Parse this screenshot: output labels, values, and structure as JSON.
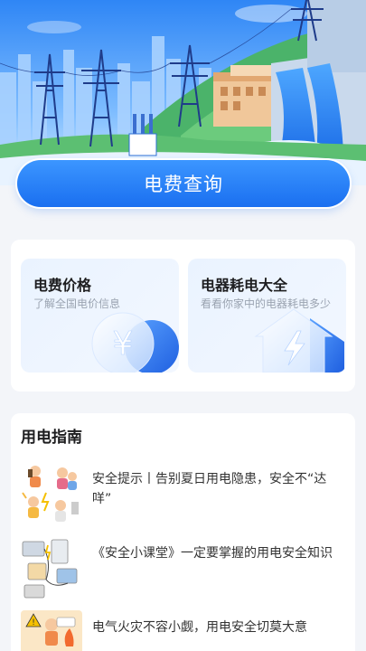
{
  "banner": {
    "query_button_label": "电费查询"
  },
  "tools": [
    {
      "title": "电费价格",
      "subtitle": "了解全国电价信息",
      "icon": "yuan-coin-icon"
    },
    {
      "title": "电器耗电大全",
      "subtitle": "看看你家中的电器耗电多少",
      "icon": "lightning-house-icon"
    }
  ],
  "guide": {
    "title": "用电指南",
    "articles": [
      {
        "text": "安全提示丨告别夏日用电隐患，安全不“达咩”"
      },
      {
        "text": "《安全小课堂》一定要掌握的用电安全知识"
      },
      {
        "text": "电气火灾不容小觑，用电安全切莫大意"
      }
    ]
  },
  "colors": {
    "accent": "#1a6ff0",
    "page_bg": "#f3f5f9",
    "card_bg": "#ffffff"
  }
}
